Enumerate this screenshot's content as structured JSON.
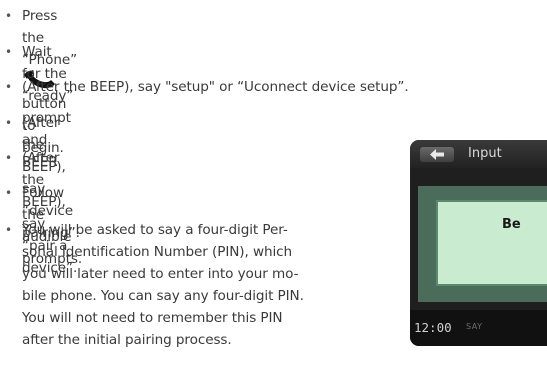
{
  "steps": {
    "step1_before": "Press the “Phone”",
    "step1_after": "button to begin.",
    "step2": "Wait for the “ready” prompt and BEEP.",
    "step3": "(After the BEEP), say \"setup\" or “Uconnect device setup”.",
    "step4": "(After the BEEP), say “device pairing”.",
    "step5": "(After the BEEP), say “pair a device”.",
    "step6": "Follow the audible prompts.",
    "step7_lines": [
      "You will be asked to say a four-digit Per-",
      "sonal Identification Number (PIN), which",
      "you will later need to enter into your mo-",
      "bile phone. You can say any four-digit PIN.",
      "You will not need to remember this PIN",
      "after the initial pairing process."
    ],
    "bullet": "•"
  },
  "icons": {
    "phone": "phone-icon",
    "back": "back-arrow-icon"
  },
  "screen": {
    "title": "Input",
    "inner_text": "Be",
    "clock": "12:00",
    "bottom_label": "SAY"
  },
  "colors": {
    "text": "#3a3a3a",
    "screen_bg": "#1f1f1f",
    "panel": "#4b6c5a",
    "inner_box": "#c9ecd0"
  }
}
